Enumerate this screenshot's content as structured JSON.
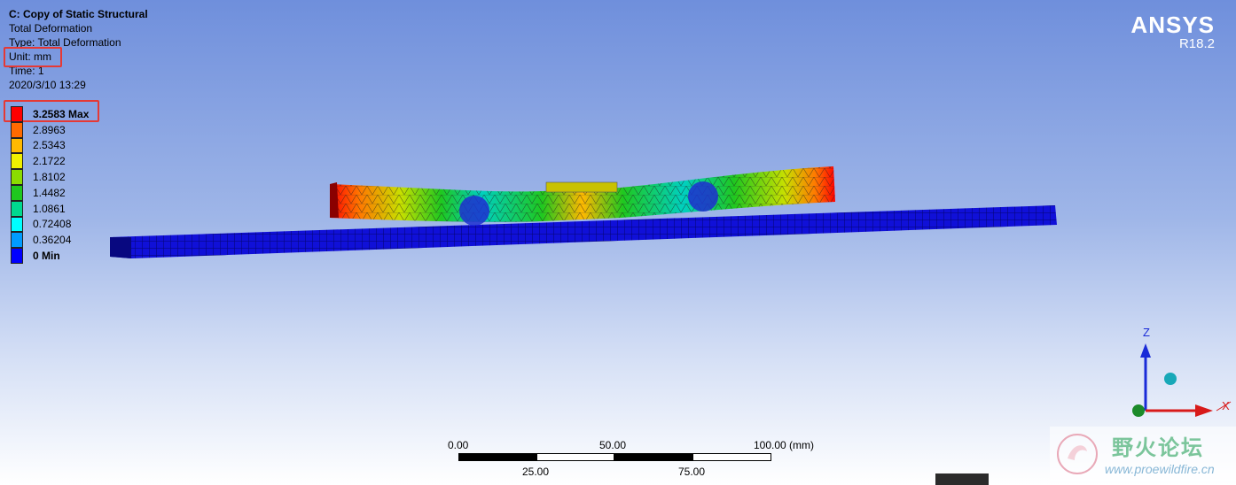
{
  "info": {
    "title": "C: Copy of Static Structural",
    "result": "Total Deformation",
    "type": "Type: Total Deformation",
    "unit": "Unit: mm",
    "time": "Time: 1",
    "date": "2020/3/10 13:29"
  },
  "legend": [
    {
      "label": "3.2583 Max",
      "color": "#ff0000",
      "bold": true
    },
    {
      "label": "2.8963",
      "color": "#ff6a00"
    },
    {
      "label": "2.5343",
      "color": "#ffb900"
    },
    {
      "label": "2.1722",
      "color": "#f0f000"
    },
    {
      "label": "1.8102",
      "color": "#8bdc00"
    },
    {
      "label": "1.4482",
      "color": "#1fc81f"
    },
    {
      "label": "1.0861",
      "color": "#00d98f"
    },
    {
      "label": "0.72408",
      "color": "#00ffff"
    },
    {
      "label": "0.36204",
      "color": "#009cff"
    },
    {
      "label": "0 Min",
      "color": "#0000ff",
      "bold": true
    }
  ],
  "brand": {
    "name": "ANSYS",
    "version": "R18.2"
  },
  "scale": {
    "top_labels": [
      "0.00",
      "50.00",
      "100.00 (mm)"
    ],
    "bottom_labels": [
      "25.00",
      "75.00"
    ]
  },
  "triad": {
    "z": "Z",
    "x": "X"
  },
  "watermark": {
    "title": "野火论坛",
    "url": "www.proewildfire.cn"
  },
  "colors": {
    "plate": "#1010d8",
    "beam_max": "#ff0000",
    "beam_mid": "#1fc81f",
    "background_top": "#6f8fdc"
  }
}
